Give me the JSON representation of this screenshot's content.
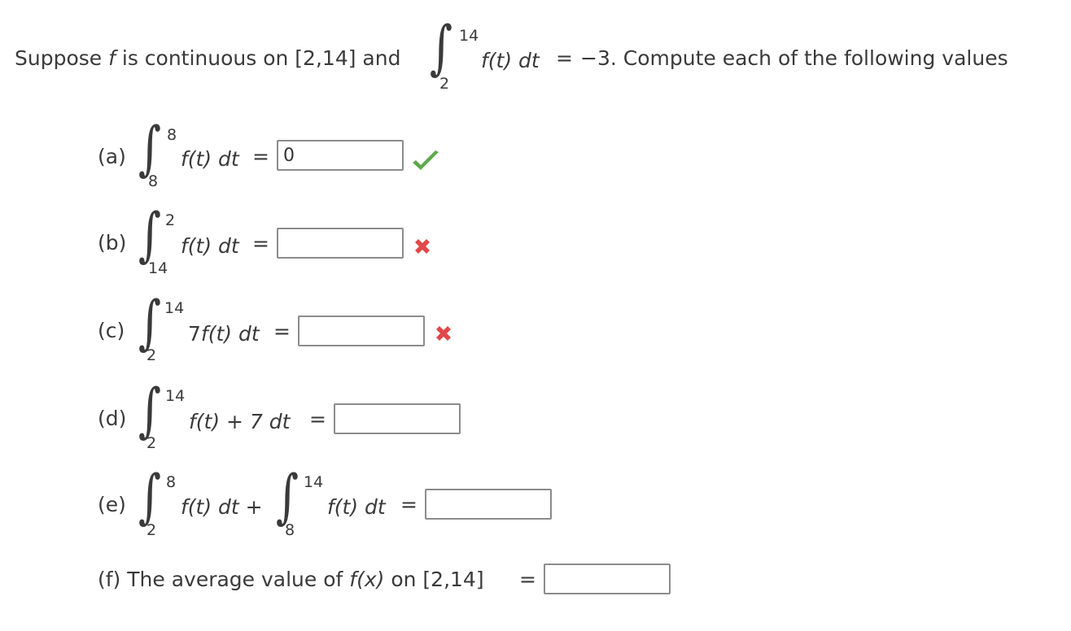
{
  "intro": {
    "prefix_1": "Suppose ",
    "f_symbol": "f",
    "prefix_2": " is continuous on [2,14] and",
    "integral": {
      "upper": "14",
      "lower": "2",
      "integrand": "f(t) dt"
    },
    "suffix_eq": "=",
    "value": "−3",
    "suffix": ". Compute each of the following values"
  },
  "parts": {
    "a": {
      "label": "(a)",
      "upper": "8",
      "lower": "8",
      "integrand": "f(t) dt",
      "eq": "=",
      "answer": "0",
      "status": "correct"
    },
    "b": {
      "label": "(b)",
      "upper": "2",
      "lower": "14",
      "integrand": "f(t) dt",
      "eq": "=",
      "answer": "",
      "status": "incorrect"
    },
    "c": {
      "label": "(c)",
      "upper": "14",
      "lower": "2",
      "coef": "7",
      "integrand": "f(t) dt",
      "eq": "=",
      "answer": "",
      "status": "incorrect"
    },
    "d": {
      "label": "(d)",
      "upper": "14",
      "lower": "2",
      "integrand": "f(t) + 7 dt",
      "eq": "=",
      "answer": ""
    },
    "e": {
      "label": "(e)",
      "upper1": "8",
      "lower1": "2",
      "integrand1": "f(t) dt +",
      "upper2": "14",
      "lower2": "8",
      "integrand2": "f(t) dt",
      "eq": "=",
      "answer": ""
    },
    "f": {
      "label": "(f) The average value of ",
      "func": "f(x)",
      "tail": " on [2,14]",
      "eq": "=",
      "answer": ""
    }
  },
  "colors": {
    "text": "#3a3a3a",
    "check_green": "#5fa84a",
    "cross_red": "#e0484a",
    "input_border": "#8c8c8c"
  },
  "icons": {
    "correct": "check-icon",
    "incorrect": "cross-icon"
  }
}
